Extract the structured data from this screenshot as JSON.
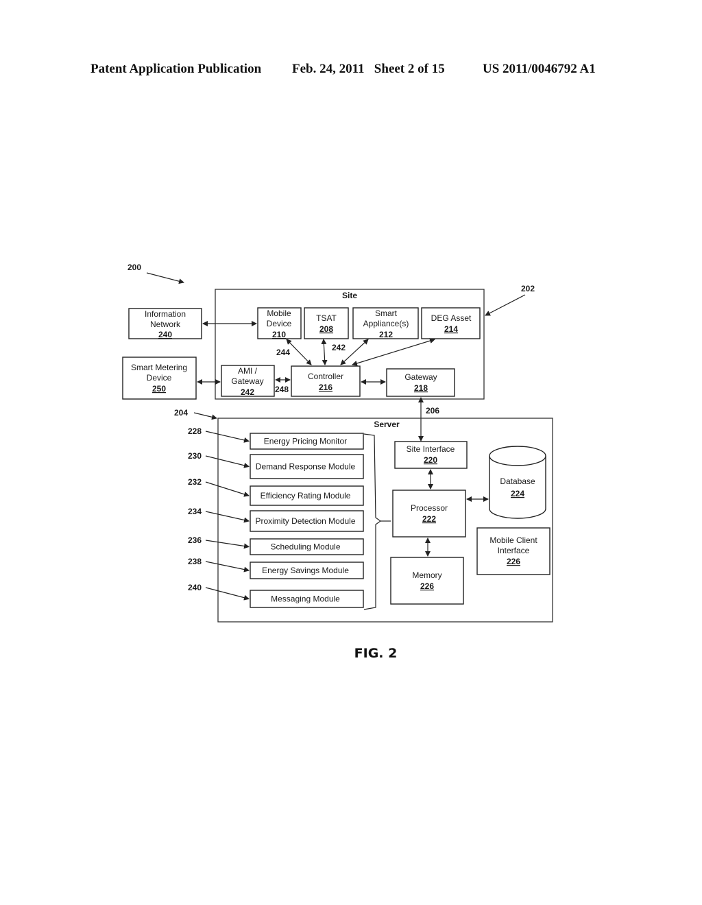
{
  "header": {
    "publication": "Patent Application Publication",
    "date_sheet": "Feb. 24, 2011   Sheet 2 of 15",
    "patent_number": "US 2011/0046792 A1"
  },
  "figure": {
    "label": "FIG. 2",
    "ref_system": "200",
    "site": {
      "ref": "202",
      "title": "Site",
      "mobile_device": {
        "line1": "Mobile",
        "line2": "Device",
        "ref": "210"
      },
      "tsat": {
        "line1": "TSAT",
        "ref": "208"
      },
      "smart_appliance": {
        "line1": "Smart",
        "line2": "Appliance(s)",
        "ref": "212"
      },
      "deg_asset": {
        "line1": "DEG Asset",
        "ref": "214"
      },
      "ami_gateway": {
        "line1": "AMI /",
        "line2": "Gateway",
        "ref": "242"
      },
      "controller": {
        "line1": "Controller",
        "ref": "216"
      },
      "gateway": {
        "line1": "Gateway",
        "ref": "218"
      },
      "link_244": "244",
      "link_242": "242",
      "link_248": "248"
    },
    "information_network": {
      "line1": "Information",
      "line2": "Network",
      "ref": "240"
    },
    "smart_metering": {
      "line1": "Smart Metering",
      "line2": "Device",
      "ref": "250"
    },
    "link_206": "206",
    "server": {
      "ref": "204",
      "title": "Server",
      "modules": [
        {
          "ref": "228",
          "label": "Energy Pricing Monitor"
        },
        {
          "ref": "230",
          "label": "Demand Response Module"
        },
        {
          "ref": "232",
          "label": "Efficiency Rating Module"
        },
        {
          "ref": "234",
          "label": "Proximity Detection Module"
        },
        {
          "ref": "236",
          "label": "Scheduling Module"
        },
        {
          "ref": "238",
          "label": "Energy Savings Module"
        },
        {
          "ref": "240",
          "label": "Messaging Module"
        }
      ],
      "site_interface": {
        "line1": "Site Interface",
        "ref": "220"
      },
      "processor": {
        "line1": "Processor",
        "ref": "222"
      },
      "memory": {
        "line1": "Memory",
        "ref": "226"
      },
      "database": {
        "line1": "Database",
        "ref": "224"
      },
      "mobile_client": {
        "line1": "Mobile Client",
        "line2": "Interface",
        "ref": "226"
      }
    }
  }
}
